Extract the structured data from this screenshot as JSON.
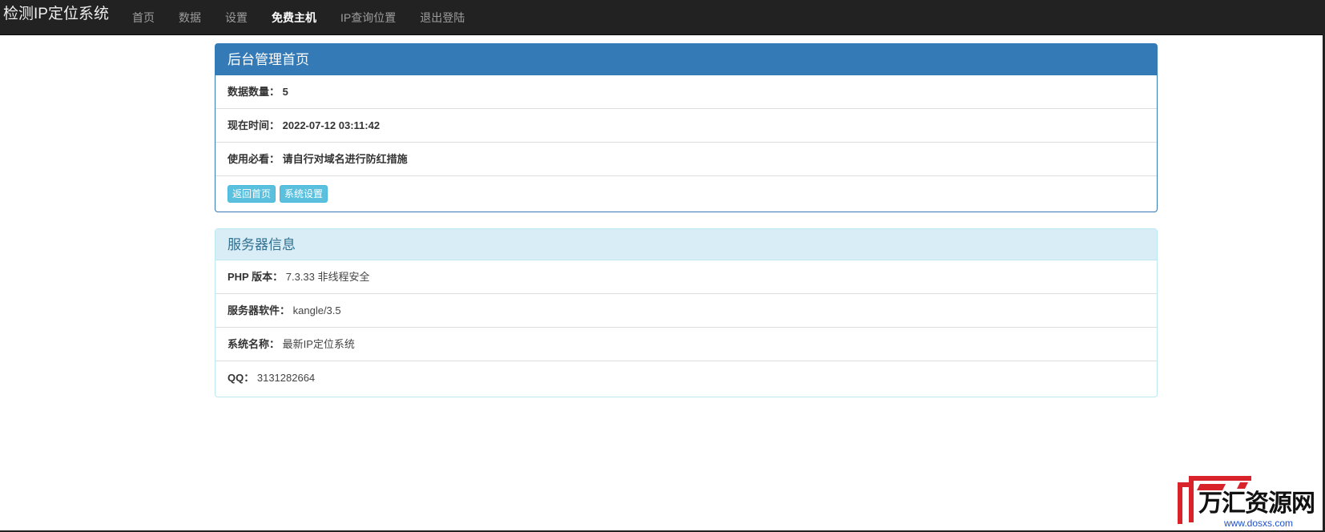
{
  "navbar": {
    "brand": "检测IP定位系统",
    "items": [
      {
        "label": "首页",
        "active": false
      },
      {
        "label": "数据",
        "active": false
      },
      {
        "label": "设置",
        "active": false
      },
      {
        "label": "免费主机",
        "active": true
      },
      {
        "label": "IP查询位置",
        "active": false
      },
      {
        "label": "退出登陆",
        "active": false
      }
    ]
  },
  "admin_panel": {
    "title": "后台管理首页",
    "rows": [
      {
        "label": "数据数量：",
        "value": "5"
      },
      {
        "label": "现在时间：",
        "value": "2022-07-12 03:11:42"
      },
      {
        "label": "使用必看：",
        "value": "请自行对域名进行防红措施"
      }
    ],
    "buttons": {
      "home": "返回首页",
      "settings": "系统设置"
    }
  },
  "server_panel": {
    "title": "服务器信息",
    "rows": [
      {
        "label": "PHP 版本：",
        "value": "7.3.33 非线程安全"
      },
      {
        "label": "服务器软件：",
        "value": "kangle/3.5"
      },
      {
        "label": "系统名称：",
        "value": "最新IP定位系统"
      },
      {
        "label": "QQ：",
        "value": "3131282664"
      }
    ]
  },
  "watermark": {
    "text": "万汇资源网",
    "url": "www.dosxs.com"
  },
  "colors": {
    "navbar_bg": "#222222",
    "primary": "#337ab7",
    "info_bg": "#d9edf7",
    "info_text": "#31708f",
    "btn_info": "#5bc0de",
    "watermark_red": "#d8232a"
  }
}
